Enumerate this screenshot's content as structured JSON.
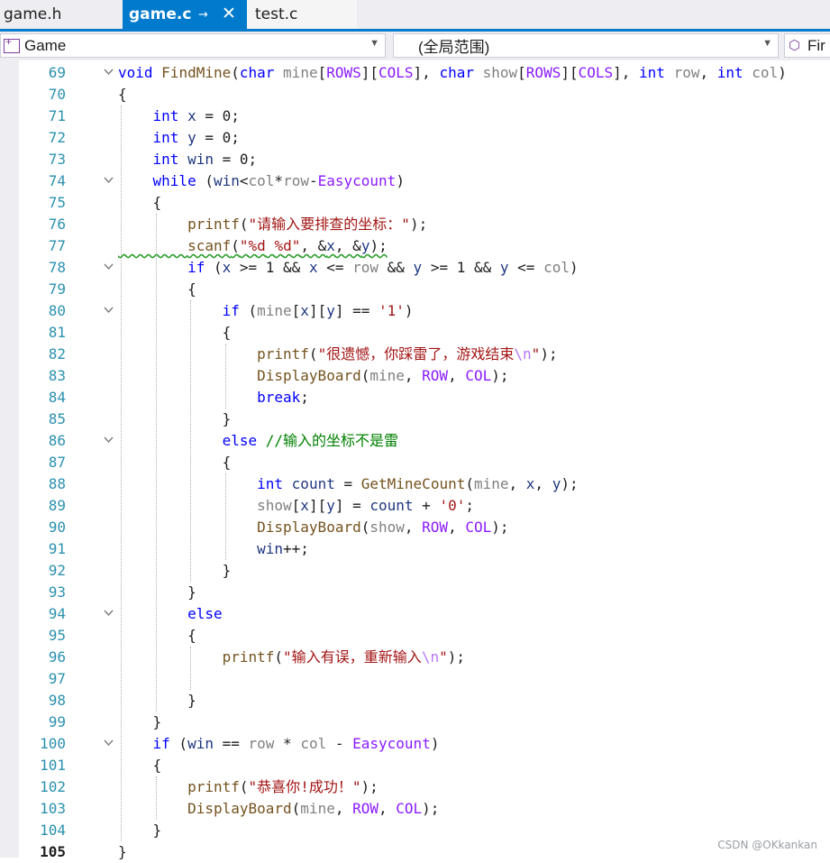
{
  "tabs": [
    {
      "label": "game.h",
      "active": false
    },
    {
      "label": "game.c",
      "active": true
    },
    {
      "label": "test.c",
      "active": false
    }
  ],
  "nav": {
    "project": "Game",
    "scope": "(全局范围)",
    "member": "Fir"
  },
  "colors": {
    "accent": "#007acc",
    "keyword": "#0000ff",
    "function": "#74531f",
    "parameter": "#808080",
    "macro": "#8a1bff",
    "string": "#a31515",
    "comment": "#008000",
    "line_number": "#2b91af"
  },
  "editor": {
    "line_numbers": [
      "69",
      "70",
      "71",
      "72",
      "73",
      "74",
      "75",
      "76",
      "77",
      "78",
      "79",
      "80",
      "81",
      "82",
      "83",
      "84",
      "85",
      "86",
      "87",
      "88",
      "89",
      "90",
      "91",
      "92",
      "93",
      "94",
      "95",
      "96",
      "97",
      "98",
      "99",
      "100",
      "101",
      "102",
      "103",
      "104",
      "105"
    ],
    "current_line": "105",
    "code_lines": [
      "void FindMine(char mine[ROWS][COLS], char show[ROWS][COLS], int row, int col)",
      "{",
      "    int x = 0;",
      "    int y = 0;",
      "    int win = 0;",
      "    while (win<col*row-Easycount)",
      "    {",
      "        printf(\"请输入要排查的坐标：\");",
      "        scanf(\"%d %d\", &x, &y);",
      "        if (x >= 1 && x <= row && y >= 1 && y <= col)",
      "        {",
      "            if (mine[x][y] == '1')",
      "            {",
      "                printf(\"很遗憾，你踩雷了，游戏结束\\n\");",
      "                DisplayBoard(mine, ROW, COL);",
      "                break;",
      "            }",
      "            else //输入的坐标不是雷",
      "            {",
      "                int count = GetMineCount(mine, x, y);",
      "                show[x][y] = count + '0';",
      "                DisplayBoard(show, ROW, COL);",
      "                win++;",
      "            }",
      "        }",
      "        else",
      "        {",
      "            printf(\"输入有误，重新输入\\n\");",
      "",
      "        }",
      "    }",
      "    if (win == row * col - Easycount)",
      "    {",
      "        printf(\"恭喜你!成功！\");",
      "        DisplayBoard(mine, ROW, COL);",
      "    }",
      "}"
    ],
    "folded_lines": [
      "69",
      "74",
      "78",
      "80",
      "86",
      "94",
      "100"
    ]
  },
  "watermark": "CSDN @OKkankan"
}
